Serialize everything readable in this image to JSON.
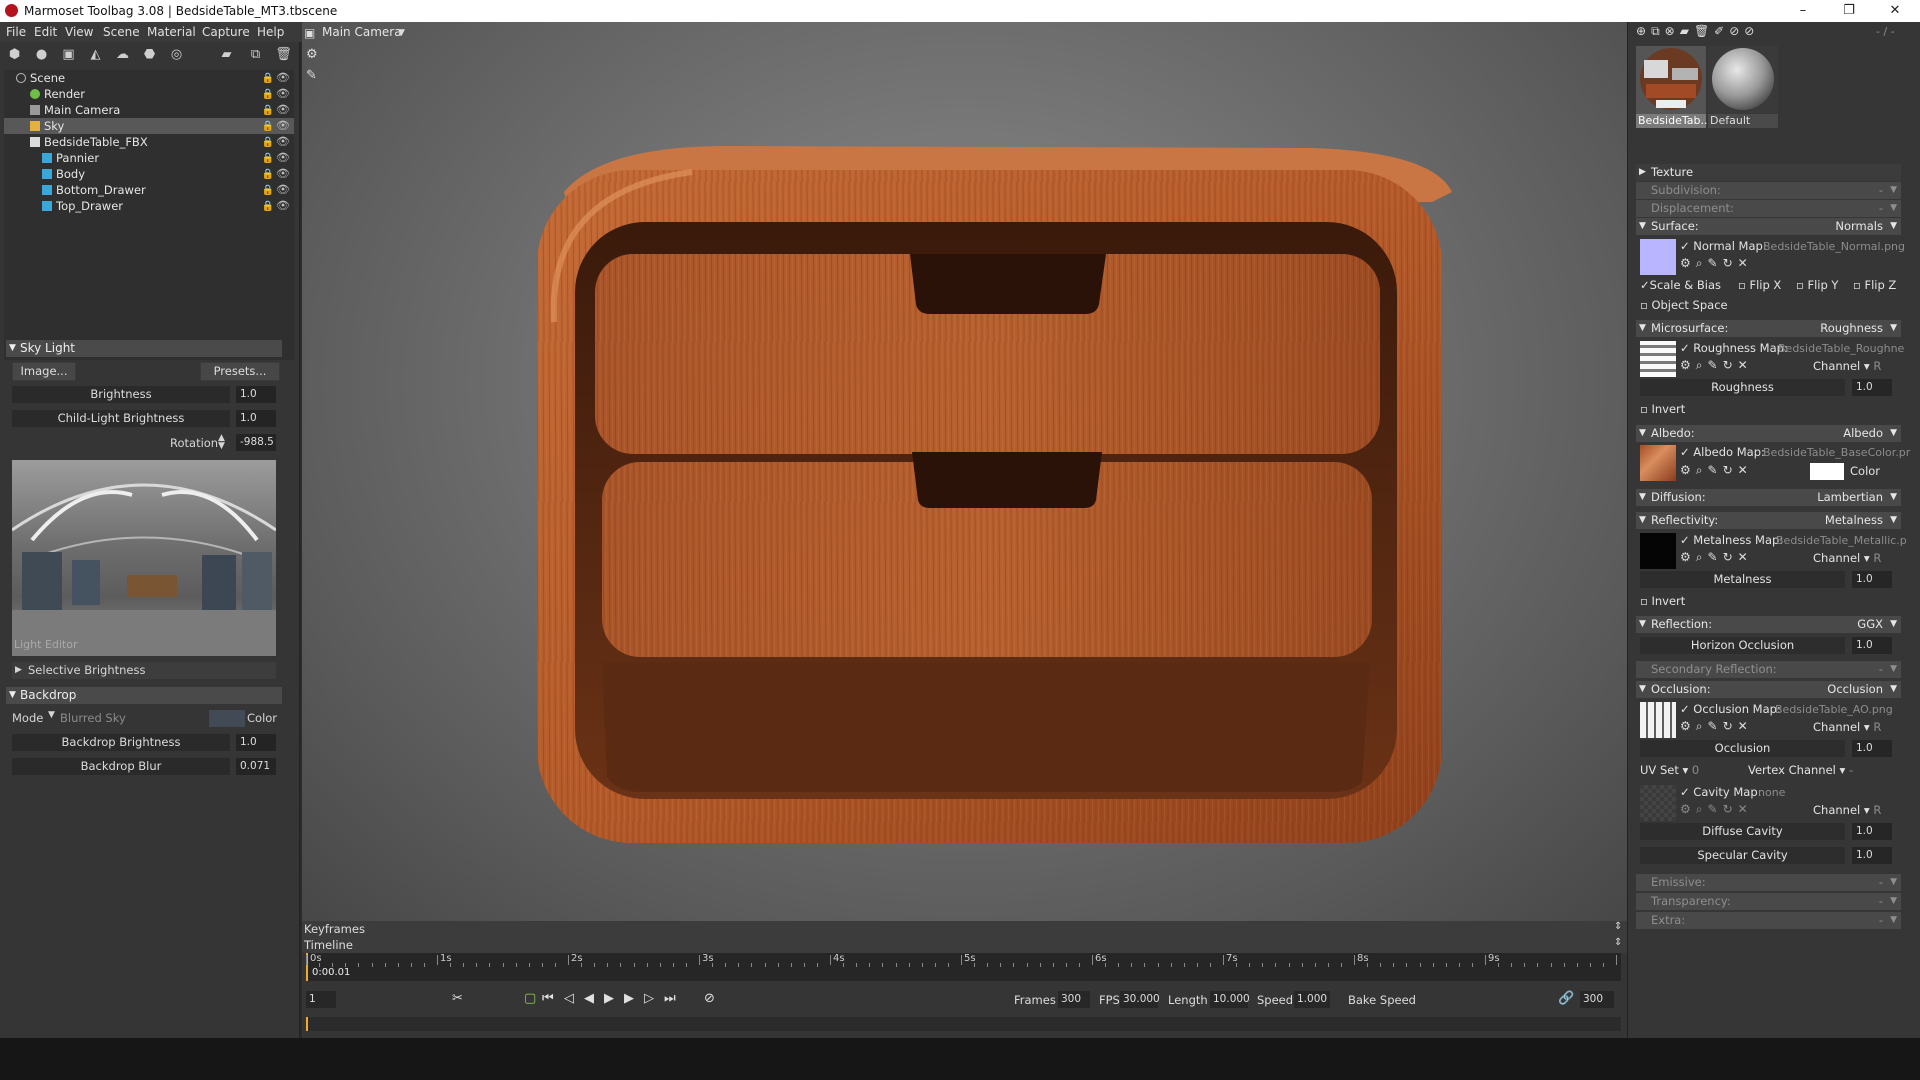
{
  "window": {
    "title": "Marmoset Toolbag 3.08  |  BedsideTable_MT3.tbscene",
    "minimize": "–",
    "maximize": "❐",
    "close": "✕"
  },
  "menu": [
    "File",
    "Edit",
    "View",
    "Scene",
    "Material",
    "Capture",
    "Help"
  ],
  "scene_tree": [
    {
      "label": "Scene",
      "indent": 0,
      "icon": "scene-icon"
    },
    {
      "label": "Render",
      "indent": 1,
      "icon": "render-icon"
    },
    {
      "label": "Main Camera",
      "indent": 1,
      "icon": "camera-icon"
    },
    {
      "label": "Sky",
      "indent": 1,
      "icon": "sky-icon",
      "selected": true
    },
    {
      "label": "BedsideTable_FBX",
      "indent": 1,
      "icon": "fbx-icon"
    },
    {
      "label": "Pannier",
      "indent": 2,
      "icon": "mesh-icon"
    },
    {
      "label": "Body",
      "indent": 2,
      "icon": "mesh-icon"
    },
    {
      "label": "Bottom_Drawer",
      "indent": 2,
      "icon": "mesh-icon"
    },
    {
      "label": "Top_Drawer",
      "indent": 2,
      "icon": "mesh-icon"
    }
  ],
  "sky_light": {
    "title": "Sky Light",
    "image_button": "Image...",
    "presets_button": "Presets...",
    "brightness_label": "Brightness",
    "brightness": "1.0",
    "child_light_label": "Child-Light Brightness",
    "child_light": "1.0",
    "rotation_label": "Rotation",
    "rotation": "-988.5",
    "light_editor": "Light Editor",
    "selective": "Selective Brightness"
  },
  "backdrop": {
    "title": "Backdrop",
    "mode_label": "Mode",
    "mode_value": "Blurred Sky",
    "color_label": "Color",
    "brightness_label": "Backdrop Brightness",
    "brightness": "1.0",
    "blur_label": "Backdrop Blur",
    "blur": "0.071"
  },
  "viewport": {
    "camera": "Main Camera"
  },
  "timeline": {
    "keyframes": "Keyframes",
    "timeline": "Timeline",
    "current_time": "0:00.01",
    "ticks": [
      "0s",
      "1s",
      "2s",
      "3s",
      "4s",
      "5s",
      "6s",
      "7s",
      "8s",
      "9s"
    ],
    "frame": "1",
    "frames_label": "Frames",
    "frames": "300",
    "fps_label": "FPS",
    "fps": "30.000",
    "length_label": "Length",
    "length": "10.000",
    "speed_label": "Speed",
    "speed": "1.000",
    "bake_speed": "Bake Speed",
    "end_frame": "300"
  },
  "materials": {
    "items": [
      "BedsideTab...",
      "Default"
    ],
    "counter": "- / -"
  },
  "material_props": {
    "texture": "Texture",
    "subdivision": "Subdivision:",
    "displacement": "Displacement:",
    "dash": "-",
    "surface": "Surface:",
    "surface_val": "Normals",
    "normal_map": "Normal Map:",
    "normal_file": "BedsideTable_Normal.png",
    "scale_bias": "Scale & Bias",
    "flip_x": "Flip X",
    "flip_y": "Flip Y",
    "flip_z": "Flip Z",
    "object_space": "Object Space",
    "microsurface": "Microsurface:",
    "microsurface_val": "Roughness",
    "roughness_map": "Roughness Map:",
    "roughness_file": "BedsideTable_Roughne",
    "channel": "Channel",
    "channel_r": "R",
    "roughness": "Roughness",
    "roughness_val": "1.0",
    "invert": "Invert",
    "albedo": "Albedo:",
    "albedo_val": "Albedo",
    "albedo_map": "Albedo Map:",
    "albedo_file": "BedsideTable_BaseColor.pr",
    "color": "Color",
    "diffusion": "Diffusion:",
    "diffusion_val": "Lambertian",
    "reflectivity": "Reflectivity:",
    "reflectivity_val": "Metalness",
    "metal_map": "Metalness Map:",
    "metal_file": "BedsideTable_Metallic.p",
    "metalness": "Metalness",
    "metalness_val": "1.0",
    "reflection": "Reflection:",
    "reflection_val": "GGX",
    "horizon": "Horizon Occlusion",
    "horizon_val": "1.0",
    "secondary": "Secondary Reflection:",
    "occlusion": "Occlusion:",
    "occlusion_val": "Occlusion",
    "occ_map": "Occlusion Map:",
    "occ_file": "BedsideTable_AO.png",
    "occ_label": "Occlusion",
    "occ_num": "1.0",
    "uv_set": "UV Set",
    "uv_val": "0",
    "vertex_channel": "Vertex Channel",
    "cavity_map": "Cavity Map:",
    "cavity_file": "none",
    "diffuse_cavity": "Diffuse Cavity",
    "diffuse_cavity_val": "1.0",
    "specular_cavity": "Specular Cavity",
    "specular_cavity_val": "1.0",
    "emissive": "Emissive:",
    "transparency": "Transparency:",
    "extra": "Extra:"
  },
  "colors": {
    "accent": "#f4a82b",
    "selection": "#585858",
    "normal_swatch": "#b9b6ff",
    "wood": "#b55a2a"
  }
}
